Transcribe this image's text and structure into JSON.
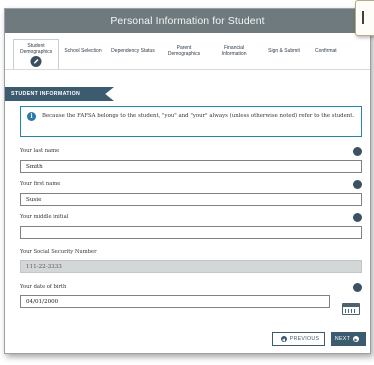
{
  "window": {
    "title": "Personal Information for Student"
  },
  "tabs": [
    {
      "label": "Student Demographics",
      "active": true
    },
    {
      "label": "School Selection",
      "active": false
    },
    {
      "label": "Dependency Status",
      "active": false
    },
    {
      "label": "Parent Demographics",
      "active": false
    },
    {
      "label": "Financial Information",
      "active": false
    },
    {
      "label": "Sign & Submit",
      "active": false
    },
    {
      "label": "Confirmat",
      "active": false
    }
  ],
  "section": {
    "title": "STUDENT INFORMATION"
  },
  "info": {
    "text": "Because the FAFSA belongs to the student, \"you\" and \"your\" always (unless otherwise noted) refer to the student."
  },
  "fields": {
    "last_name": {
      "label": "Your last name",
      "value": "Smith"
    },
    "first_name": {
      "label": "Your first name",
      "value": "Susie"
    },
    "middle_initial": {
      "label": "Your middle initial",
      "value": ""
    },
    "ssn": {
      "label": "Your Social Security Number",
      "value": "111-22-3333"
    },
    "dob": {
      "label": "Your date of birth",
      "value": "04/01/2000"
    }
  },
  "buttons": {
    "previous": "PREVIOUS",
    "next": "NEXT"
  },
  "colors": {
    "titlebar": "#6e7a7d",
    "accent": "#3d5b6e",
    "info_border": "#1f86a6"
  }
}
